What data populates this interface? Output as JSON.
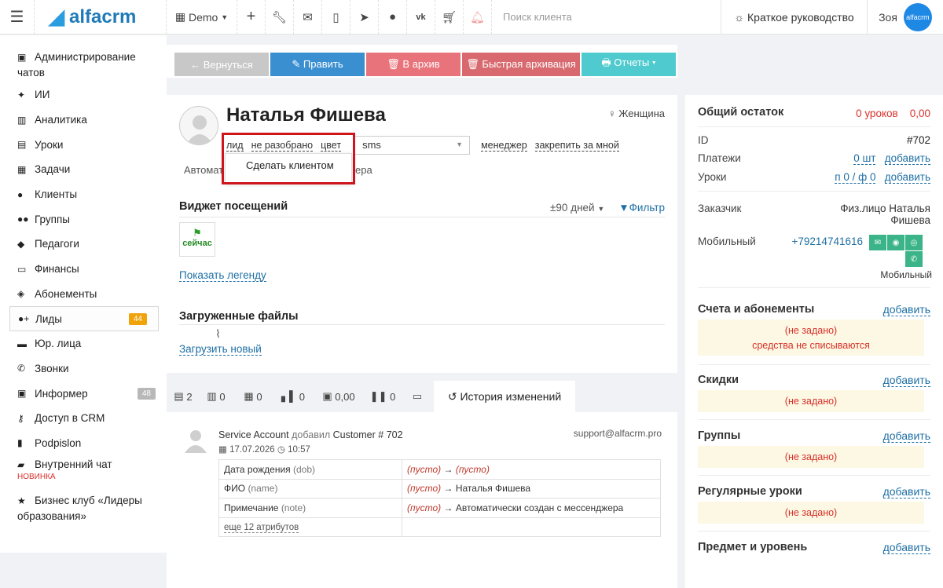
{
  "topbar": {
    "logo": "alfacrm",
    "branch": "Demo",
    "search_placeholder": "Поиск клиента",
    "guide": "Краткое руководство",
    "user_name": "Зоя",
    "avatar_text": "alfacrm"
  },
  "sidebar": {
    "items": [
      {
        "label": "Администрирование чатов",
        "icon": "chat-admin-icon"
      },
      {
        "label": "ИИ",
        "icon": "sparkle-icon"
      },
      {
        "label": "Аналитика",
        "icon": "map-icon"
      },
      {
        "label": "Уроки",
        "icon": "calendar-icon"
      },
      {
        "label": "Задачи",
        "icon": "clipboard-icon"
      },
      {
        "label": "Клиенты",
        "icon": "user-icon"
      },
      {
        "label": "Группы",
        "icon": "users-icon"
      },
      {
        "label": "Педагоги",
        "icon": "graduation-cap-icon"
      },
      {
        "label": "Финансы",
        "icon": "money-icon"
      },
      {
        "label": "Абонементы",
        "icon": "tag-icon"
      },
      {
        "label": "Лиды",
        "icon": "user-plus-icon",
        "badge": "44"
      },
      {
        "label": "Юр. лица",
        "icon": "briefcase-icon"
      },
      {
        "label": "Звонки",
        "icon": "phone-icon"
      },
      {
        "label": "Информер",
        "icon": "inbox-icon",
        "badge": "48"
      },
      {
        "label": "Доступ в CRM",
        "icon": "key-icon"
      },
      {
        "label": "Podpislon",
        "icon": "file-icon"
      },
      {
        "label": "Внутренний чат",
        "icon": "comment-icon",
        "note": "НОВИНКА"
      },
      {
        "label": "Бизнес клуб «Лидеры образования»",
        "icon": "star-icon"
      }
    ]
  },
  "actions": {
    "back": "← Вернуться",
    "edit": "✎ Править",
    "archive": "🗑 В архив",
    "quick_archive": "🗑 Быстрая архивация",
    "reports": "🖶 Отчеты ▾"
  },
  "profile": {
    "name": "Наталья Фишева",
    "gender": "Женщина",
    "status_lead": "лид",
    "status_unsorted": "не разобрано",
    "status_color": "цвет",
    "sms_value": "sms",
    "manager": "менеджер",
    "pin": "закрепить за мной",
    "dropdown_item": "Сделать клиентом",
    "auto_partial_left": "Автомат",
    "auto_partial_right": "ера"
  },
  "visits": {
    "title": "Виджет посещений",
    "period": "±90 дней",
    "filter": "Фильтр",
    "now": "сейчас",
    "legend_link": "Показать легенду"
  },
  "files": {
    "title": "Загруженные файлы",
    "upload": "Загрузить новый"
  },
  "tabs": [
    {
      "icon": "comments-icon",
      "label": "2"
    },
    {
      "icon": "book-icon",
      "label": "0"
    },
    {
      "icon": "document-icon",
      "label": "0"
    },
    {
      "icon": "bar-chart-icon",
      "label": "0"
    },
    {
      "icon": "gift-icon",
      "label": "0,00"
    },
    {
      "icon": "pause-icon",
      "label": "0"
    },
    {
      "icon": "banknote-icon",
      "label": ""
    },
    {
      "icon": "history-icon",
      "label": "История изменений"
    }
  ],
  "history": {
    "actor": "Service Account",
    "verb": "добавил",
    "object": "Customer # 702",
    "date": "17.07.2026",
    "time": "10:57",
    "email": "support@alfacrm.pro",
    "rows": [
      {
        "field": "Дата рождения",
        "key": "(dob)",
        "old": "(пусто)",
        "arrow": "→",
        "new": "(пусто)",
        "new_empty": true
      },
      {
        "field": "ФИО",
        "key": "(name)",
        "old": "(пусто)",
        "arrow": "→",
        "new": "Наталья Фишева",
        "new_empty": false
      },
      {
        "field": "Примечание",
        "key": "(note)",
        "old": "(пусто)",
        "arrow": "→",
        "new": "Автоматически создан с мессенджера",
        "new_empty": false
      }
    ],
    "more": "еще 12 атрибутов"
  },
  "right": {
    "balance_title": "Общий остаток",
    "balance_lessons": "0 уроков",
    "balance_sum": "0,00",
    "id_label": "ID",
    "id_value": "#702",
    "payments_label": "Платежи",
    "payments_value": "0 шт",
    "lessons_label": "Уроки",
    "lessons_value": "п 0 / ф 0",
    "add": "добавить",
    "customer_label": "Заказчик",
    "customer_value_1": "Физ.лицо Наталья",
    "customer_value_2": "Фишева",
    "mobile_label": "Мобильный",
    "mobile_value": "+79214741616",
    "mobile_caption": "Мобильный",
    "invoices_title": "Счета и абонементы",
    "not_set": "(не задано)",
    "no_charge": "средства не списываются",
    "discounts_title": "Скидки",
    "groups_title": "Группы",
    "regular_title": "Регулярные уроки",
    "subject_title": "Предмет и уровень"
  },
  "colors": {
    "btn_back": "#c8c8c8",
    "btn_edit": "#3a8fd0",
    "btn_archive": "#e9737a",
    "btn_quick": "#d86a6f",
    "btn_reports": "#4fcbcf",
    "link_blue": "#1d6fa5",
    "red": "#d9302a",
    "badge_orange": "#f0a30a"
  }
}
